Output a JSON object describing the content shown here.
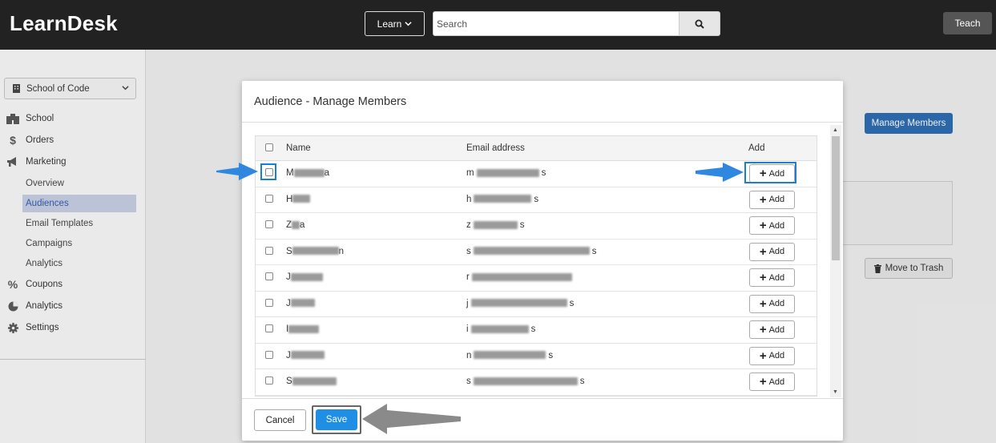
{
  "header": {
    "logo": "LearnDesk",
    "learn_label": "Learn",
    "search_placeholder": "Search",
    "teach_label": "Teach"
  },
  "sidebar": {
    "school_select": "School of Code",
    "items": [
      {
        "label": "School",
        "icon": "building-icon"
      },
      {
        "label": "Orders",
        "icon": "dollar-icon"
      },
      {
        "label": "Marketing",
        "icon": "megaphone-icon"
      }
    ],
    "marketing_sub": [
      "Overview",
      "Audiences",
      "Email Templates",
      "Campaigns",
      "Analytics"
    ],
    "active_sub": "Audiences",
    "more_items": [
      {
        "label": "Coupons",
        "icon": "percent-icon"
      },
      {
        "label": "Analytics",
        "icon": "pie-chart-icon"
      },
      {
        "label": "Settings",
        "icon": "gear-icon"
      }
    ]
  },
  "background": {
    "manage_members_label": "Manage Members",
    "move_to_trash_label": "Move to Trash"
  },
  "modal": {
    "title": "Audience - Manage Members",
    "columns": {
      "name": "Name",
      "email": "Email address",
      "add": "Add"
    },
    "add_label": "Add",
    "rows": [
      {
        "name": "M",
        "name_tail": "a",
        "email": "m",
        "email_tail": "s"
      },
      {
        "name": "H",
        "name_tail": "",
        "email": "h",
        "email_tail": "s"
      },
      {
        "name": "Z",
        "name_tail": "a",
        "email": "z",
        "email_tail": "s"
      },
      {
        "name": "S",
        "name_tail": "n",
        "email": "s",
        "email_tail": "s"
      },
      {
        "name": "J",
        "name_tail": "",
        "email": "r",
        "email_tail": ""
      },
      {
        "name": "J",
        "name_tail": "",
        "email": "j",
        "email_tail": "s"
      },
      {
        "name": "I",
        "name_tail": "",
        "email": "i",
        "email_tail": "s"
      },
      {
        "name": "J",
        "name_tail": "",
        "email": "n",
        "email_tail": "s"
      },
      {
        "name": "S",
        "name_tail": "",
        "email": "s",
        "email_tail": "s"
      }
    ],
    "cancel_label": "Cancel",
    "save_label": "Save"
  },
  "colors": {
    "accent": "#1f8fe6",
    "header_bg": "#222222",
    "annotation": "#1a7fd4"
  }
}
